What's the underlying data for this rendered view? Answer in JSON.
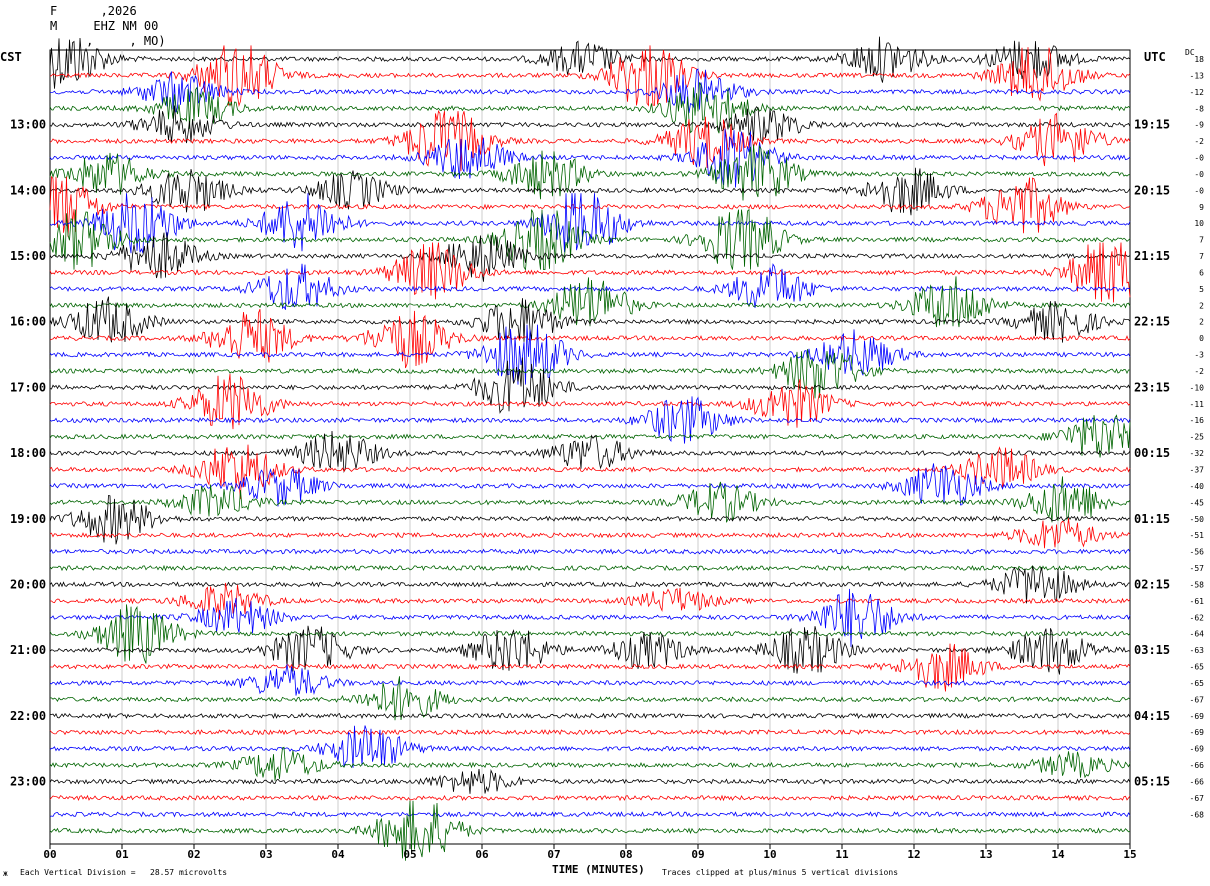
{
  "header": {
    "date_line": "F      ,2026",
    "station_line": "M     EHZ NM 00",
    "location_line": "     ,     , MO)"
  },
  "labels": {
    "left_tz": "CST",
    "right_tz": "UTC",
    "dc": "DC",
    "xlabel": "TIME (MINUTES)",
    "scale_note": "Each Vertical Division =   28.57 microvolts",
    "clip_note": "Traces clipped at plus/minus 5 vertical divisions",
    "corner_mark": "ж"
  },
  "chart_data": {
    "type": "line",
    "title": "",
    "xlabel": "TIME (MINUTES)",
    "x_ticks": [
      "00",
      "01",
      "02",
      "03",
      "04",
      "05",
      "06",
      "07",
      "08",
      "09",
      "10",
      "11",
      "12",
      "13",
      "14",
      "15"
    ],
    "xlim": [
      0,
      15
    ],
    "trace_minutes": 15,
    "trace_count": 48,
    "trace_colors": [
      "#000000",
      "#ff0000",
      "#0000ff",
      "#006400"
    ],
    "left_hour_labels": [
      "13:00",
      "14:00",
      "15:00",
      "16:00",
      "17:00",
      "18:00",
      "19:00",
      "20:00",
      "21:00",
      "22:00",
      "23:00"
    ],
    "right_hour_labels": [
      "19:15",
      "20:15",
      "21:15",
      "22:15",
      "23:15",
      "00:15",
      "01:15",
      "02:15",
      "03:15",
      "04:15",
      "05:15"
    ],
    "dc_offsets": [
      "18",
      "-13",
      "-12",
      "-8",
      "-9",
      "-2",
      "-0",
      "-0",
      "-0",
      "9",
      "10",
      "7",
      "7",
      "6",
      "5",
      "2",
      "2",
      "0",
      "-3",
      "-2",
      "-10",
      "-11",
      "-16",
      "-25",
      "-32",
      "-37",
      "-40",
      "-45",
      "-50",
      "-51",
      "-56",
      "-57",
      "-58",
      "-61",
      "-62",
      "-64",
      "-63",
      "-65",
      "-65",
      "-67",
      "-69",
      "-69",
      "-69",
      "-66",
      "-66",
      "-67",
      "-68"
    ],
    "events": [
      {
        "trace": 0,
        "minute": 0.2,
        "amp": 2.5
      },
      {
        "trace": 0,
        "minute": 7.4,
        "amp": 1.4
      },
      {
        "trace": 0,
        "minute": 11.6,
        "amp": 1.8
      },
      {
        "trace": 0,
        "minute": 13.6,
        "amp": 1.8
      },
      {
        "trace": 1,
        "minute": 2.6,
        "amp": 3.0
      },
      {
        "trace": 1,
        "minute": 8.3,
        "amp": 3.0
      },
      {
        "trace": 1,
        "minute": 13.7,
        "amp": 2.5
      },
      {
        "trace": 2,
        "minute": 1.8,
        "amp": 1.6
      },
      {
        "trace": 2,
        "minute": 9.0,
        "amp": 1.8
      },
      {
        "trace": 3,
        "minute": 2.0,
        "amp": 1.6
      },
      {
        "trace": 3,
        "minute": 9.1,
        "amp": 2.4
      },
      {
        "trace": 4,
        "minute": 1.8,
        "amp": 1.5
      },
      {
        "trace": 4,
        "minute": 9.9,
        "amp": 1.5
      },
      {
        "trace": 5,
        "minute": 5.5,
        "amp": 3.0
      },
      {
        "trace": 5,
        "minute": 9.1,
        "amp": 2.2
      },
      {
        "trace": 5,
        "minute": 14.0,
        "amp": 2.2
      },
      {
        "trace": 6,
        "minute": 5.8,
        "amp": 2.0
      },
      {
        "trace": 6,
        "minute": 9.5,
        "amp": 2.5
      },
      {
        "trace": 7,
        "minute": 0.8,
        "amp": 1.8
      },
      {
        "trace": 7,
        "minute": 6.9,
        "amp": 2.0
      },
      {
        "trace": 7,
        "minute": 9.8,
        "amp": 2.5
      },
      {
        "trace": 8,
        "minute": 1.9,
        "amp": 2.0
      },
      {
        "trace": 8,
        "minute": 4.2,
        "amp": 1.5
      },
      {
        "trace": 8,
        "minute": 11.9,
        "amp": 2.0
      },
      {
        "trace": 9,
        "minute": 0.1,
        "amp": 3.0
      },
      {
        "trace": 9,
        "minute": 13.5,
        "amp": 2.5
      },
      {
        "trace": 10,
        "minute": 1.2,
        "amp": 3.0
      },
      {
        "trace": 10,
        "minute": 3.5,
        "amp": 2.5
      },
      {
        "trace": 10,
        "minute": 7.4,
        "amp": 3.0
      },
      {
        "trace": 11,
        "minute": 0.4,
        "amp": 2.5
      },
      {
        "trace": 11,
        "minute": 6.8,
        "amp": 3.0
      },
      {
        "trace": 11,
        "minute": 9.6,
        "amp": 3.0
      },
      {
        "trace": 12,
        "minute": 1.5,
        "amp": 2.0
      },
      {
        "trace": 12,
        "minute": 6.0,
        "amp": 2.0
      },
      {
        "trace": 13,
        "minute": 5.3,
        "amp": 2.5
      },
      {
        "trace": 13,
        "minute": 14.7,
        "amp": 3.0
      },
      {
        "trace": 14,
        "minute": 3.4,
        "amp": 2.0
      },
      {
        "trace": 14,
        "minute": 10.0,
        "amp": 2.0
      },
      {
        "trace": 15,
        "minute": 7.5,
        "amp": 2.4
      },
      {
        "trace": 15,
        "minute": 12.5,
        "amp": 2.4
      },
      {
        "trace": 16,
        "minute": 0.8,
        "amp": 2.0
      },
      {
        "trace": 16,
        "minute": 6.5,
        "amp": 2.0
      },
      {
        "trace": 16,
        "minute": 14.0,
        "amp": 1.6
      },
      {
        "trace": 17,
        "minute": 2.8,
        "amp": 2.4
      },
      {
        "trace": 17,
        "minute": 5.0,
        "amp": 2.4
      },
      {
        "trace": 18,
        "minute": 6.6,
        "amp": 3.0
      },
      {
        "trace": 18,
        "minute": 11.2,
        "amp": 2.0
      },
      {
        "trace": 19,
        "minute": 10.7,
        "amp": 2.4
      },
      {
        "trace": 20,
        "minute": 6.5,
        "amp": 2.5
      },
      {
        "trace": 21,
        "minute": 2.5,
        "amp": 2.5
      },
      {
        "trace": 21,
        "minute": 10.3,
        "amp": 2.0
      },
      {
        "trace": 22,
        "minute": 8.8,
        "amp": 2.0
      },
      {
        "trace": 23,
        "minute": 14.6,
        "amp": 2.0
      },
      {
        "trace": 24,
        "minute": 4.0,
        "amp": 1.8
      },
      {
        "trace": 24,
        "minute": 7.5,
        "amp": 1.5
      },
      {
        "trace": 25,
        "minute": 2.6,
        "amp": 2.4
      },
      {
        "trace": 25,
        "minute": 13.2,
        "amp": 1.8
      },
      {
        "trace": 26,
        "minute": 3.2,
        "amp": 1.6
      },
      {
        "trace": 26,
        "minute": 12.4,
        "amp": 2.0
      },
      {
        "trace": 27,
        "minute": 2.3,
        "amp": 1.4
      },
      {
        "trace": 27,
        "minute": 9.3,
        "amp": 1.6
      },
      {
        "trace": 27,
        "minute": 14.1,
        "amp": 2.0
      },
      {
        "trace": 28,
        "minute": 0.9,
        "amp": 2.0
      },
      {
        "trace": 29,
        "minute": 14.0,
        "amp": 1.4
      },
      {
        "trace": 32,
        "minute": 13.7,
        "amp": 1.8
      },
      {
        "trace": 33,
        "minute": 2.4,
        "amp": 1.4
      },
      {
        "trace": 33,
        "minute": 8.7,
        "amp": 1.0
      },
      {
        "trace": 34,
        "minute": 2.6,
        "amp": 1.5
      },
      {
        "trace": 34,
        "minute": 11.2,
        "amp": 2.5
      },
      {
        "trace": 35,
        "minute": 1.2,
        "amp": 2.5
      },
      {
        "trace": 36,
        "minute": 3.6,
        "amp": 2.0
      },
      {
        "trace": 36,
        "minute": 6.4,
        "amp": 2.0
      },
      {
        "trace": 36,
        "minute": 8.3,
        "amp": 1.5
      },
      {
        "trace": 36,
        "minute": 10.5,
        "amp": 2.0
      },
      {
        "trace": 36,
        "minute": 13.9,
        "amp": 2.0
      },
      {
        "trace": 37,
        "minute": 12.4,
        "amp": 2.0
      },
      {
        "trace": 38,
        "minute": 3.3,
        "amp": 1.4
      },
      {
        "trace": 39,
        "minute": 4.9,
        "amp": 1.8
      },
      {
        "trace": 42,
        "minute": 4.4,
        "amp": 2.0
      },
      {
        "trace": 43,
        "minute": 3.2,
        "amp": 1.4
      },
      {
        "trace": 43,
        "minute": 14.2,
        "amp": 1.0
      },
      {
        "trace": 44,
        "minute": 5.9,
        "amp": 1.0
      },
      {
        "trace": 47,
        "minute": 5.1,
        "amp": 3.0
      }
    ]
  }
}
